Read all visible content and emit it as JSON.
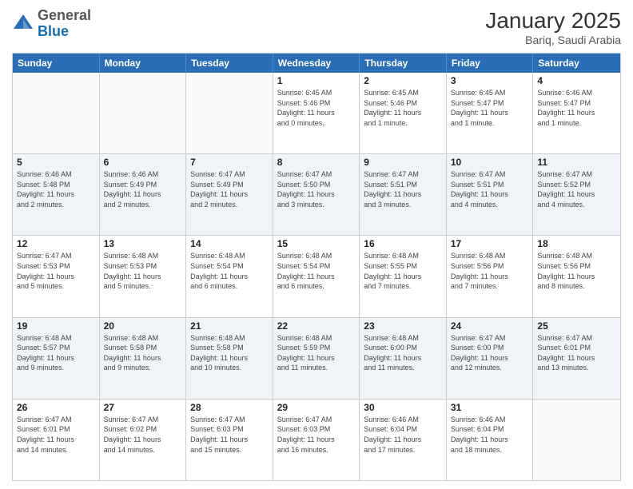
{
  "header": {
    "logo_line1": "General",
    "logo_line2": "Blue",
    "month": "January 2025",
    "location": "Bariq, Saudi Arabia"
  },
  "days_of_week": [
    "Sunday",
    "Monday",
    "Tuesday",
    "Wednesday",
    "Thursday",
    "Friday",
    "Saturday"
  ],
  "rows": [
    {
      "alt": false,
      "cells": [
        {
          "day": "",
          "info": ""
        },
        {
          "day": "",
          "info": ""
        },
        {
          "day": "",
          "info": ""
        },
        {
          "day": "1",
          "info": "Sunrise: 6:45 AM\nSunset: 5:46 PM\nDaylight: 11 hours\nand 0 minutes."
        },
        {
          "day": "2",
          "info": "Sunrise: 6:45 AM\nSunset: 5:46 PM\nDaylight: 11 hours\nand 1 minute."
        },
        {
          "day": "3",
          "info": "Sunrise: 6:45 AM\nSunset: 5:47 PM\nDaylight: 11 hours\nand 1 minute."
        },
        {
          "day": "4",
          "info": "Sunrise: 6:46 AM\nSunset: 5:47 PM\nDaylight: 11 hours\nand 1 minute."
        }
      ]
    },
    {
      "alt": true,
      "cells": [
        {
          "day": "5",
          "info": "Sunrise: 6:46 AM\nSunset: 5:48 PM\nDaylight: 11 hours\nand 2 minutes."
        },
        {
          "day": "6",
          "info": "Sunrise: 6:46 AM\nSunset: 5:49 PM\nDaylight: 11 hours\nand 2 minutes."
        },
        {
          "day": "7",
          "info": "Sunrise: 6:47 AM\nSunset: 5:49 PM\nDaylight: 11 hours\nand 2 minutes."
        },
        {
          "day": "8",
          "info": "Sunrise: 6:47 AM\nSunset: 5:50 PM\nDaylight: 11 hours\nand 3 minutes."
        },
        {
          "day": "9",
          "info": "Sunrise: 6:47 AM\nSunset: 5:51 PM\nDaylight: 11 hours\nand 3 minutes."
        },
        {
          "day": "10",
          "info": "Sunrise: 6:47 AM\nSunset: 5:51 PM\nDaylight: 11 hours\nand 4 minutes."
        },
        {
          "day": "11",
          "info": "Sunrise: 6:47 AM\nSunset: 5:52 PM\nDaylight: 11 hours\nand 4 minutes."
        }
      ]
    },
    {
      "alt": false,
      "cells": [
        {
          "day": "12",
          "info": "Sunrise: 6:47 AM\nSunset: 5:53 PM\nDaylight: 11 hours\nand 5 minutes."
        },
        {
          "day": "13",
          "info": "Sunrise: 6:48 AM\nSunset: 5:53 PM\nDaylight: 11 hours\nand 5 minutes."
        },
        {
          "day": "14",
          "info": "Sunrise: 6:48 AM\nSunset: 5:54 PM\nDaylight: 11 hours\nand 6 minutes."
        },
        {
          "day": "15",
          "info": "Sunrise: 6:48 AM\nSunset: 5:54 PM\nDaylight: 11 hours\nand 6 minutes."
        },
        {
          "day": "16",
          "info": "Sunrise: 6:48 AM\nSunset: 5:55 PM\nDaylight: 11 hours\nand 7 minutes."
        },
        {
          "day": "17",
          "info": "Sunrise: 6:48 AM\nSunset: 5:56 PM\nDaylight: 11 hours\nand 7 minutes."
        },
        {
          "day": "18",
          "info": "Sunrise: 6:48 AM\nSunset: 5:56 PM\nDaylight: 11 hours\nand 8 minutes."
        }
      ]
    },
    {
      "alt": true,
      "cells": [
        {
          "day": "19",
          "info": "Sunrise: 6:48 AM\nSunset: 5:57 PM\nDaylight: 11 hours\nand 9 minutes."
        },
        {
          "day": "20",
          "info": "Sunrise: 6:48 AM\nSunset: 5:58 PM\nDaylight: 11 hours\nand 9 minutes."
        },
        {
          "day": "21",
          "info": "Sunrise: 6:48 AM\nSunset: 5:58 PM\nDaylight: 11 hours\nand 10 minutes."
        },
        {
          "day": "22",
          "info": "Sunrise: 6:48 AM\nSunset: 5:59 PM\nDaylight: 11 hours\nand 11 minutes."
        },
        {
          "day": "23",
          "info": "Sunrise: 6:48 AM\nSunset: 6:00 PM\nDaylight: 11 hours\nand 11 minutes."
        },
        {
          "day": "24",
          "info": "Sunrise: 6:47 AM\nSunset: 6:00 PM\nDaylight: 11 hours\nand 12 minutes."
        },
        {
          "day": "25",
          "info": "Sunrise: 6:47 AM\nSunset: 6:01 PM\nDaylight: 11 hours\nand 13 minutes."
        }
      ]
    },
    {
      "alt": false,
      "cells": [
        {
          "day": "26",
          "info": "Sunrise: 6:47 AM\nSunset: 6:01 PM\nDaylight: 11 hours\nand 14 minutes."
        },
        {
          "day": "27",
          "info": "Sunrise: 6:47 AM\nSunset: 6:02 PM\nDaylight: 11 hours\nand 14 minutes."
        },
        {
          "day": "28",
          "info": "Sunrise: 6:47 AM\nSunset: 6:03 PM\nDaylight: 11 hours\nand 15 minutes."
        },
        {
          "day": "29",
          "info": "Sunrise: 6:47 AM\nSunset: 6:03 PM\nDaylight: 11 hours\nand 16 minutes."
        },
        {
          "day": "30",
          "info": "Sunrise: 6:46 AM\nSunset: 6:04 PM\nDaylight: 11 hours\nand 17 minutes."
        },
        {
          "day": "31",
          "info": "Sunrise: 6:46 AM\nSunset: 6:04 PM\nDaylight: 11 hours\nand 18 minutes."
        },
        {
          "day": "",
          "info": ""
        }
      ]
    }
  ]
}
